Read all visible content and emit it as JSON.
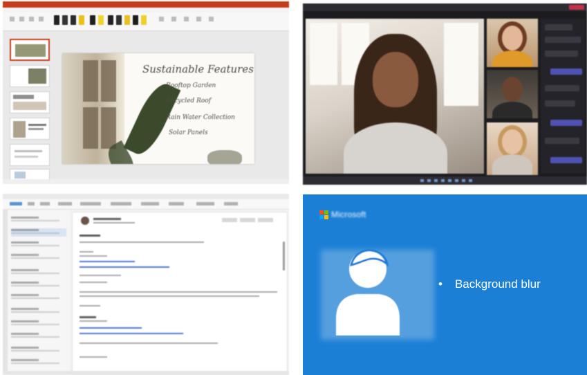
{
  "powerpoint": {
    "slide_title": "Sustainable Features",
    "bullets": [
      "Rooftop Garden",
      "Recycled Roof",
      "Rain Water Collection",
      "Solar Panels"
    ],
    "accent_color": "#c43e1c"
  },
  "teams": {
    "accent_color": "#6264a7",
    "leave_color": "#c4314b"
  },
  "outlook": {
    "accent_color": "#0f6cbd"
  },
  "blur_card": {
    "brand": "Microsoft",
    "bullet_marker": "•",
    "bullet_text": "Background blur",
    "background_color": "#1b7fd6",
    "logo_colors": [
      "#f25022",
      "#7fba00",
      "#00a4ef",
      "#ffb900"
    ]
  }
}
